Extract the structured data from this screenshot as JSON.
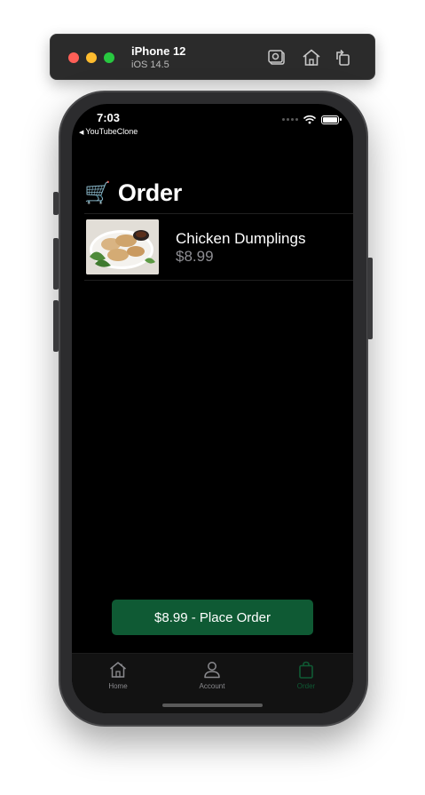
{
  "simulator": {
    "device_name": "iPhone 12",
    "os_version": "iOS 14.5"
  },
  "status_bar": {
    "time": "7:03",
    "back_app": "YouTubeClone"
  },
  "header": {
    "icon": "cart-icon",
    "title": "Order"
  },
  "order": {
    "items": [
      {
        "name": "Chicken Dumplings",
        "price": "$8.99",
        "image": "dumplings-photo"
      }
    ]
  },
  "place_order": {
    "label": "$8.99 - Place Order",
    "color": "#0f5a34"
  },
  "tabs": [
    {
      "label": "Home",
      "icon": "house-icon",
      "active": false
    },
    {
      "label": "Account",
      "icon": "person-icon",
      "active": false
    },
    {
      "label": "Order",
      "icon": "bag-icon",
      "active": true
    }
  ],
  "colors": {
    "accent": "#0f5a34",
    "background": "#000000",
    "secondary_text": "#8e8e93"
  }
}
